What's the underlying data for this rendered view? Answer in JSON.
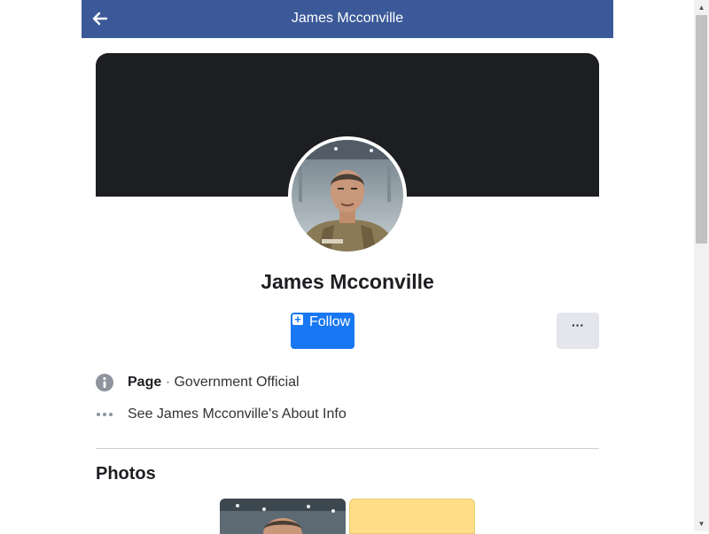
{
  "header": {
    "title": "James Mcconville",
    "back_icon": "arrow-left-icon",
    "background": "#3b5998"
  },
  "profile": {
    "name": "James Mcconville",
    "follow_label": "Follow",
    "more_label": "···",
    "accent": "#1877f2"
  },
  "info": {
    "type_label": "Page",
    "separator": "·",
    "category": "Government Official",
    "about_link": "See James Mcconville's About Info"
  },
  "photos": {
    "title": "Photos"
  }
}
